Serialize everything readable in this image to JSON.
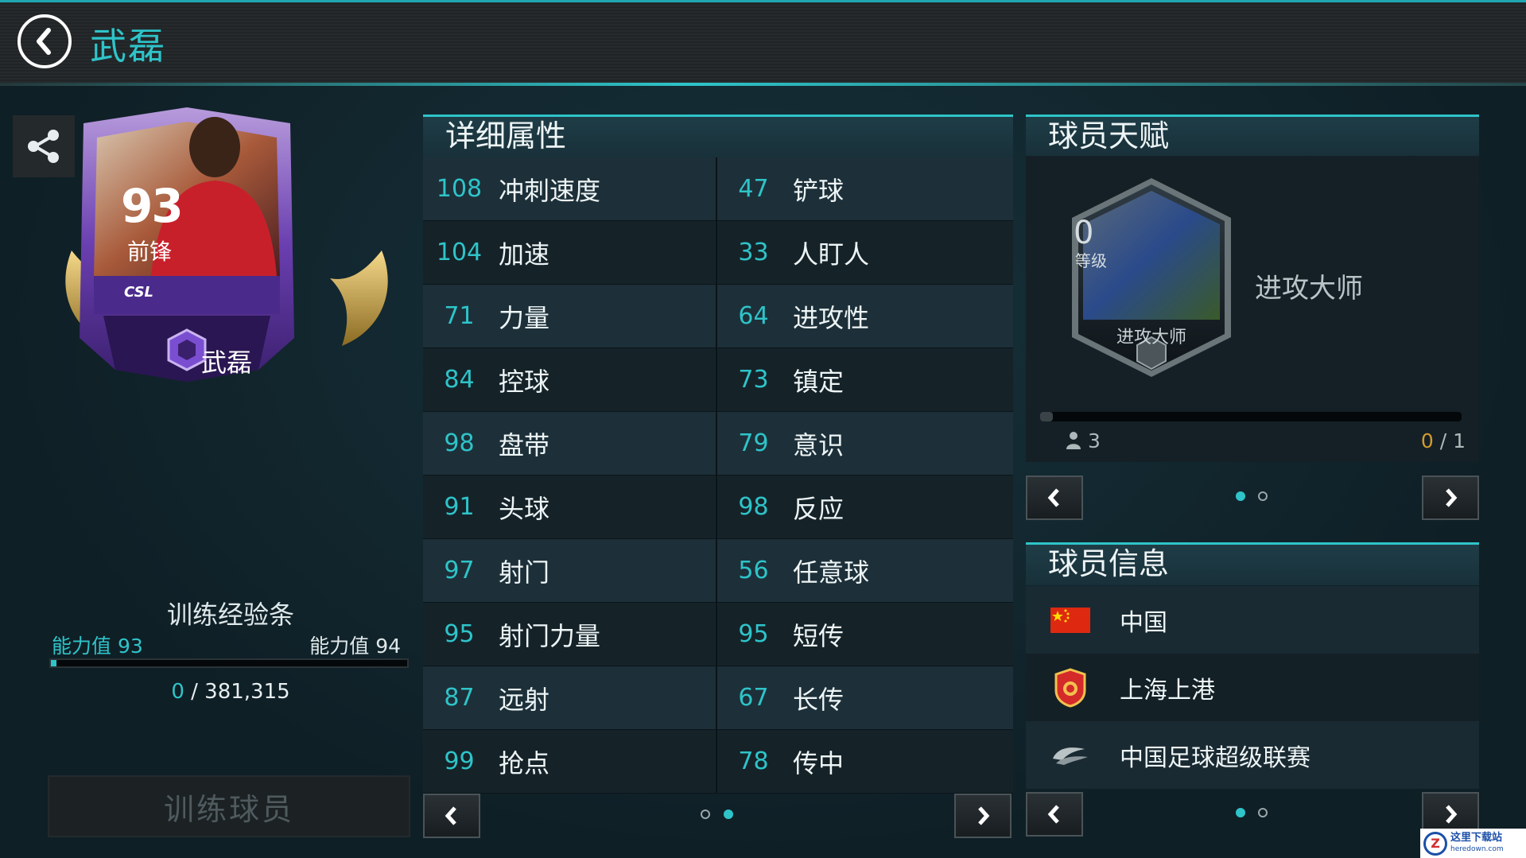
{
  "header": {
    "title": "武磊"
  },
  "card": {
    "rating": "93",
    "position": "前锋",
    "league_logo": "CSL",
    "name": "武磊"
  },
  "training": {
    "title": "训练经验条",
    "current_label": "能力值",
    "current_value": "93",
    "next_label": "能力值",
    "next_value": "94",
    "progress_current": "0",
    "progress_sep": "/",
    "progress_total": "381,315",
    "progress_fraction": 0,
    "button_label": "训练球员"
  },
  "attributes": {
    "title": "详细属性",
    "rows": [
      {
        "left": {
          "value": "108",
          "name": "冲刺速度"
        },
        "right": {
          "value": "47",
          "name": "铲球"
        }
      },
      {
        "left": {
          "value": "104",
          "name": "加速"
        },
        "right": {
          "value": "33",
          "name": "人盯人"
        }
      },
      {
        "left": {
          "value": "71",
          "name": "力量"
        },
        "right": {
          "value": "64",
          "name": "进攻性"
        }
      },
      {
        "left": {
          "value": "84",
          "name": "控球"
        },
        "right": {
          "value": "73",
          "name": "镇定"
        }
      },
      {
        "left": {
          "value": "98",
          "name": "盘带"
        },
        "right": {
          "value": "79",
          "name": "意识"
        }
      },
      {
        "left": {
          "value": "91",
          "name": "头球"
        },
        "right": {
          "value": "98",
          "name": "反应"
        }
      },
      {
        "left": {
          "value": "97",
          "name": "射门"
        },
        "right": {
          "value": "56",
          "name": "任意球"
        }
      },
      {
        "left": {
          "value": "95",
          "name": "射门力量"
        },
        "right": {
          "value": "95",
          "name": "短传"
        }
      },
      {
        "left": {
          "value": "87",
          "name": "远射"
        },
        "right": {
          "value": "67",
          "name": "长传"
        }
      },
      {
        "left": {
          "value": "99",
          "name": "抢点"
        },
        "right": {
          "value": "78",
          "name": "传中"
        }
      }
    ],
    "pager": {
      "pages": 2,
      "active": 1
    }
  },
  "talent": {
    "title": "球员天赋",
    "level": "0",
    "level_label": "等级",
    "badge_label": "进攻大师",
    "name": "进攻大师",
    "users": "3",
    "progress_current": "0",
    "progress_sep": "/",
    "progress_total": "1",
    "progress_fraction": 0,
    "pager": {
      "pages": 2,
      "active": 0
    }
  },
  "info": {
    "title": "球员信息",
    "items": [
      {
        "icon": "china-flag-icon",
        "text": "中国"
      },
      {
        "icon": "shanghai-sipg-crest-icon",
        "text": "上海上港"
      },
      {
        "icon": "csl-logo-icon",
        "text": "中国足球超级联赛"
      }
    ],
    "pager": {
      "pages": 2,
      "active": 0
    }
  },
  "watermark": {
    "title": "这里下载站",
    "url": "heredown.com"
  },
  "colors": {
    "accent": "#2ec4c9",
    "gold": "#d39b2e",
    "card_purple": "#6a3fb0"
  }
}
